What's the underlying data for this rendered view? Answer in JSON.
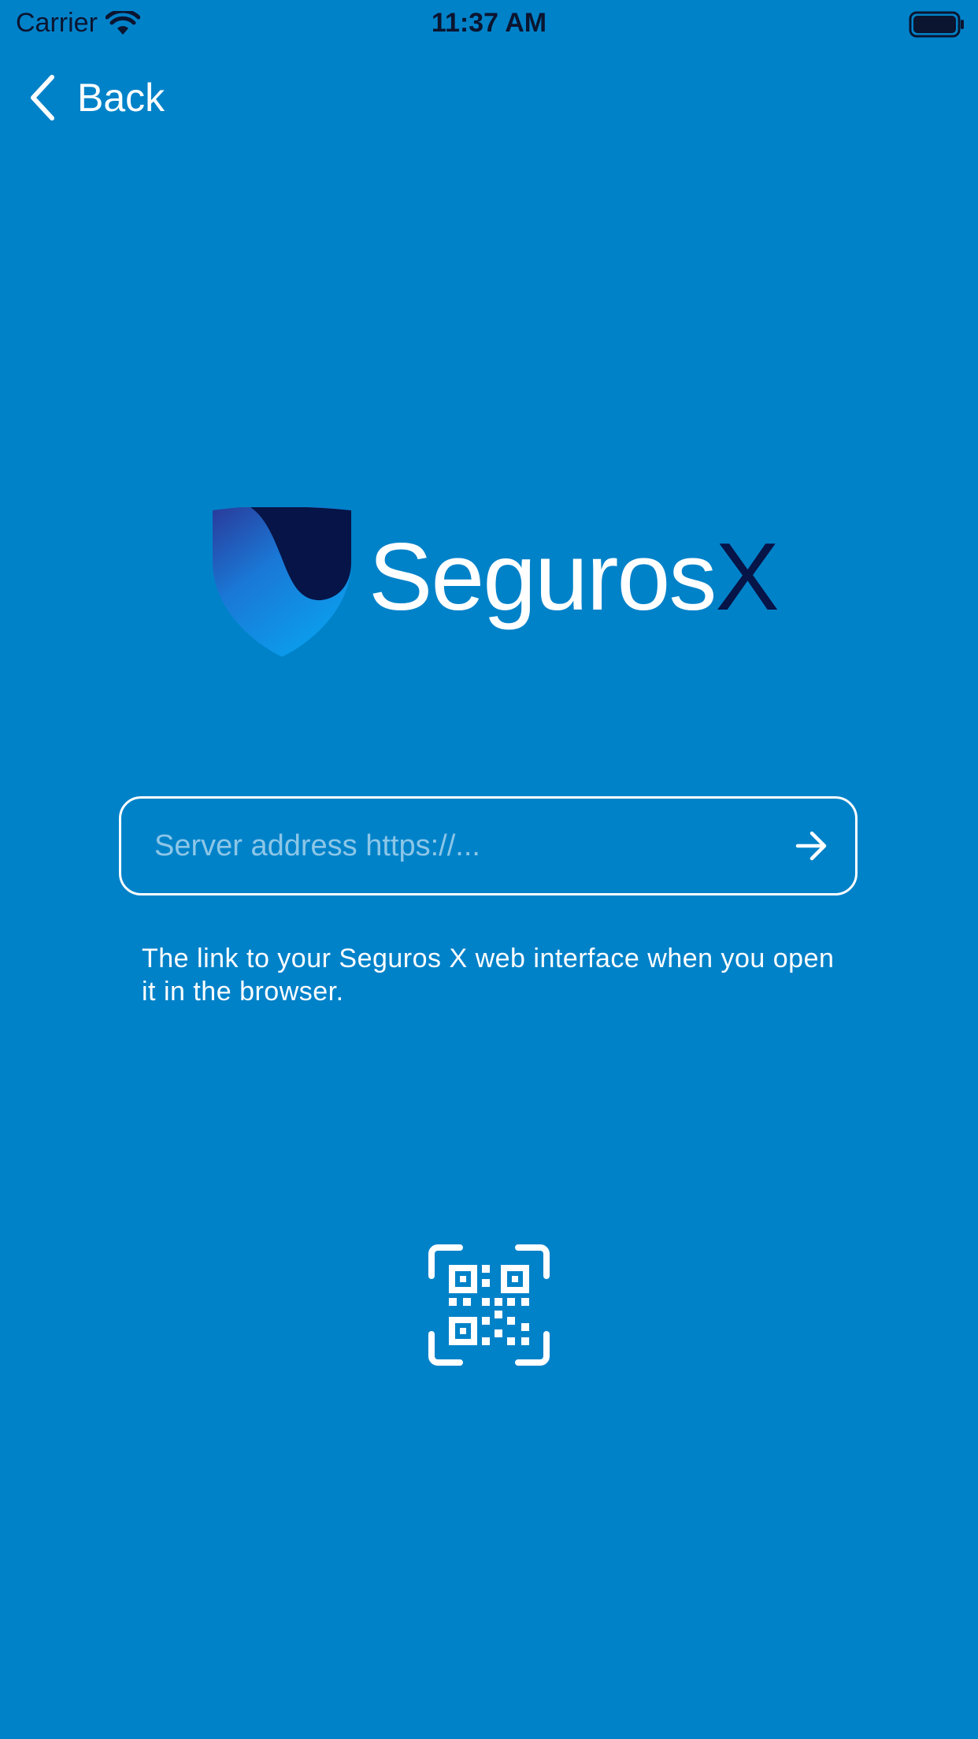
{
  "status_bar": {
    "carrier": "Carrier",
    "time": "11:37 AM"
  },
  "nav": {
    "back_label": "Back"
  },
  "logo": {
    "word": "Seguros",
    "accent": "X"
  },
  "server_field": {
    "value": "",
    "placeholder": "Server address https://..."
  },
  "helper_text": "The link to your Seguros X web interface when you open it in the browser.",
  "icons": {
    "back": "chevron-left-icon",
    "submit": "arrow-right-icon",
    "qr": "qr-code-scan-icon",
    "wifi": "wifi-icon",
    "battery": "battery-icon"
  },
  "colors": {
    "background": "#0082C9",
    "logo_accent": "#061447",
    "text": "#FFFFFF"
  }
}
